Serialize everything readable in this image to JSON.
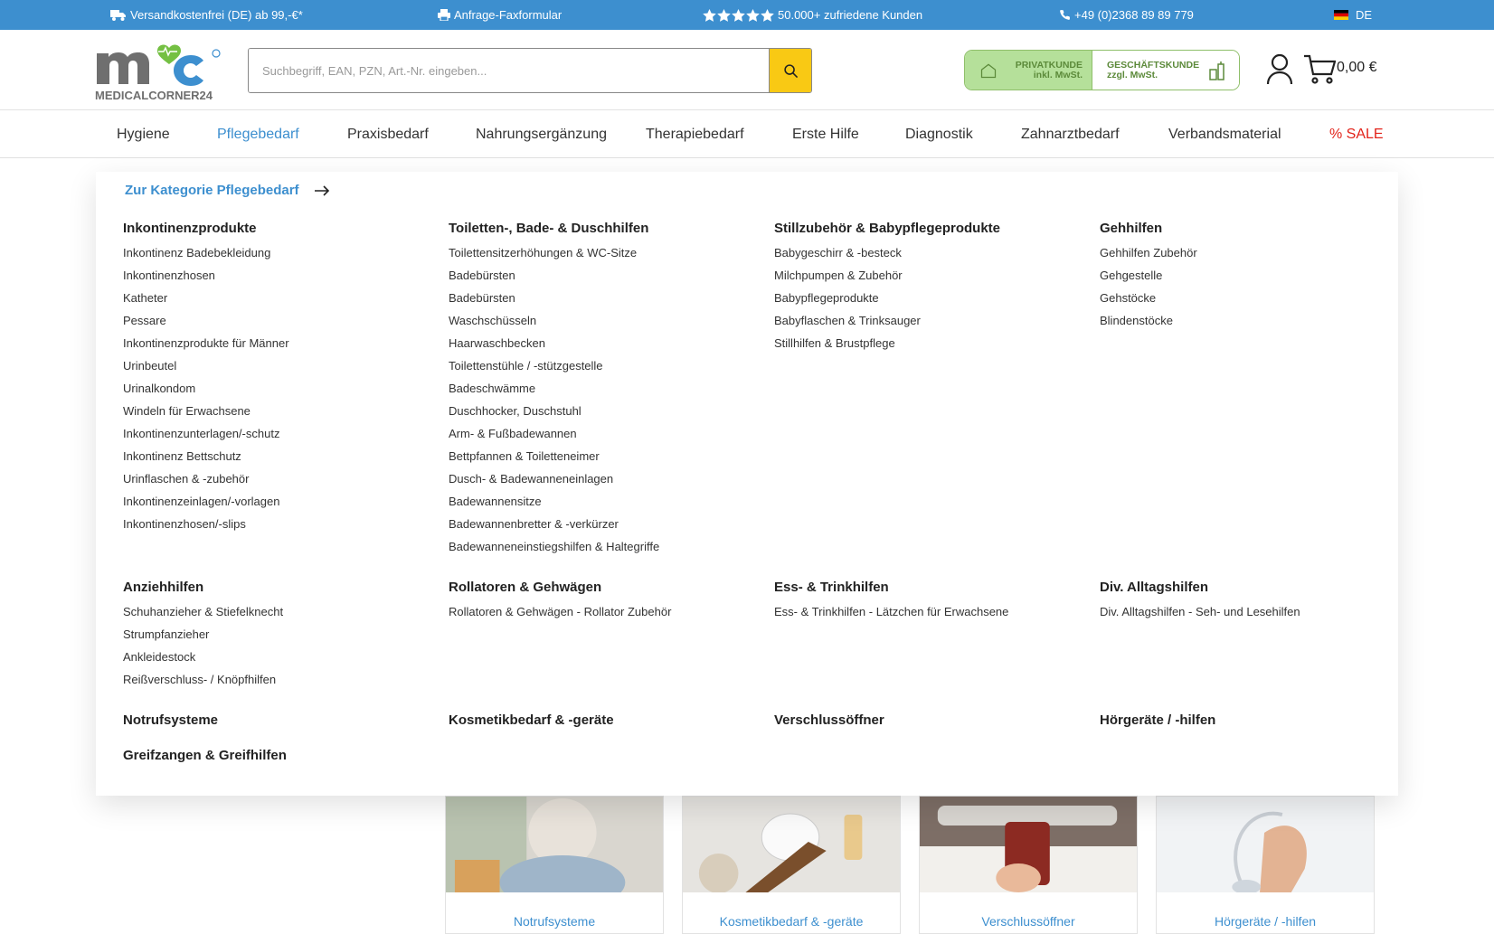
{
  "topbar": {
    "shipping": "Versandkostenfrei (DE) ab 99,-€*",
    "fax": "Anfrage-Faxformular",
    "rating": "50.000+ zufriedene Kunden",
    "phone": "+49 (0)2368 89 89 779",
    "language": "DE"
  },
  "header": {
    "logo_text": "MEDICALCORNER24",
    "search_placeholder": "Suchbegriff, EAN, PZN, Art.-Nr. eingeben...",
    "private_label": "PRIVATKUNDE",
    "private_sub": "inkl. MwSt.",
    "business_label": "GESCHÄFTSKUNDE",
    "business_sub": "zzgl. MwSt.",
    "cart_total": "0,00 €"
  },
  "nav": [
    "Hygiene",
    "Pflegebedarf",
    "Praxisbedarf",
    "Nahrungsergänzung",
    "Therapiebedarf",
    "Erste Hilfe",
    "Diagnostik",
    "Zahnarztbedarf",
    "Verbandsmaterial",
    "% SALE"
  ],
  "mega": {
    "category_link": "Zur Kategorie Pflegebedarf",
    "row1": [
      {
        "title": "Inkontinenzprodukte",
        "items": [
          "Inkontinenz Badebekleidung",
          "Inkontinenzhosen",
          "Katheter",
          "Pessare",
          "Inkontinenzprodukte für Männer",
          "Urinbeutel",
          "Urinalkondom",
          "Windeln für Erwachsene",
          "Inkontinenzunterlagen/-schutz",
          "Inkontinenz Bettschutz",
          "Urinflaschen & -zubehör",
          "Inkontinenzeinlagen/-vorlagen",
          "Inkontinenzhosen/-slips"
        ]
      },
      {
        "title": "Toiletten-, Bade- & Duschhilfen",
        "items": [
          "Toilettensitzerhöhungen & WC-Sitze",
          "Badebürsten",
          "Badebürsten",
          "Waschschüsseln",
          "Haarwaschbecken",
          "Toilettenstühle / -stützgestelle",
          "Badeschwämme",
          "Duschhocker, Duschstuhl",
          "Arm- & Fußbadewannen",
          "Bettpfannen & Toiletteneimer",
          "Dusch- & Badewanneneinlagen",
          "Badewannensitze",
          "Badewannenbretter & -verkürzer",
          "Badewanneneinstiegshilfen & Haltegriffe"
        ]
      },
      {
        "title": "Stillzubehör & Babypflegeprodukte",
        "items": [
          "Babygeschirr & -besteck",
          "Milchpumpen & Zubehör",
          "Babypflegeprodukte",
          "Babyflaschen & Trinksauger",
          "Stillhilfen & Brustpflege"
        ]
      },
      {
        "title": "Gehhilfen",
        "items": [
          "Gehhilfen Zubehör",
          "Gehgestelle",
          "Gehstöcke",
          "Blindenstöcke"
        ]
      }
    ],
    "row2": [
      {
        "title": "Anziehhilfen",
        "items": [
          "Schuhanzieher & Stiefelknecht",
          "Strumpfanzieher",
          "Ankleidestock",
          "Reißverschluss- / Knöpfhilfen"
        ]
      },
      {
        "title": "Rollatoren & Gehwägen",
        "items": [
          "Rollatoren & Gehwägen - Rollator Zubehör"
        ]
      },
      {
        "title": "Ess- & Trinkhilfen",
        "items": [
          "Ess- & Trinkhilfen - Lätzchen für Erwachsene"
        ]
      },
      {
        "title": "Div. Alltagshilfen",
        "items": [
          "Div. Alltagshilfen - Seh- und Lesehilfen"
        ]
      }
    ],
    "row3": [
      "Notrufsysteme",
      "Kosmetikbedarf & -geräte",
      "Verschlussöffner",
      "Hörgeräte / -hilfen"
    ],
    "row4": [
      "Greifzangen & Greifhilfen"
    ]
  },
  "cards": [
    "Notrufsysteme",
    "Kosmetikbedarf & -geräte",
    "Verschlussöffner",
    "Hörgeräte / -hilfen"
  ],
  "colors": {
    "accent": "#3d8fcf",
    "sale": "#e2231a",
    "search_button": "#f9c914",
    "private_bg": "#b5e09a"
  }
}
